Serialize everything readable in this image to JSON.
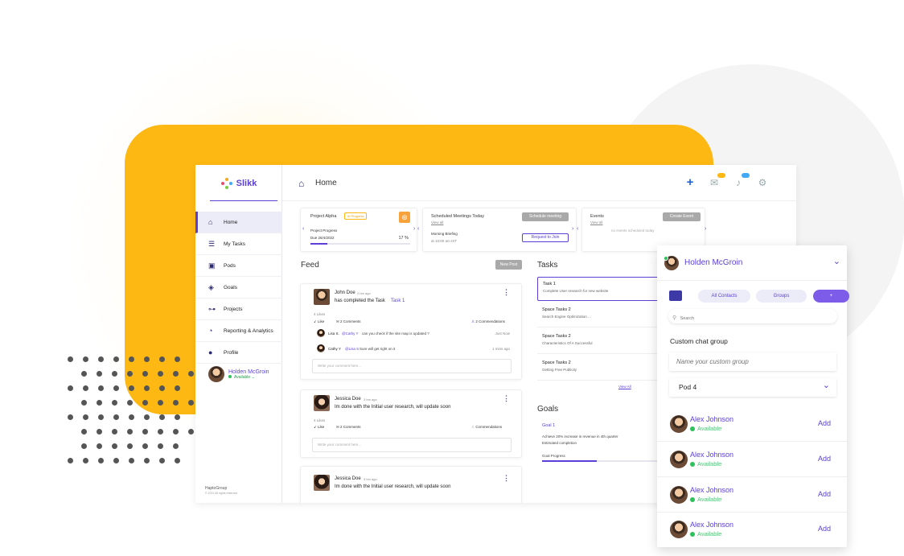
{
  "brand": {
    "name": "Slikk",
    "footer_line1": "HaptoGroup",
    "footer_line2": "© 2021 All rights reserved"
  },
  "colors": {
    "accent": "#5b3fd6",
    "yellow": "#fdb813",
    "available": "#2ec05a"
  },
  "sidebar": {
    "items": [
      {
        "label": "Home",
        "icon": "home-icon"
      },
      {
        "label": "My Tasks",
        "icon": "list-icon"
      },
      {
        "label": "Pods",
        "icon": "pod-icon"
      },
      {
        "label": "Goals",
        "icon": "target-icon"
      },
      {
        "label": "Projects",
        "icon": "projects-icon"
      },
      {
        "label": "Reporting & Analytics",
        "icon": "chart-icon"
      },
      {
        "label": "Profile",
        "icon": "profile-icon"
      }
    ],
    "user": {
      "name": "Holden McGroin",
      "status": "Available ⌄"
    }
  },
  "topbar": {
    "title": "Home"
  },
  "project_card": {
    "name": "Project Alpha",
    "badge": "In Progress",
    "progress_label": "Project Progress",
    "due": "Due 26/4/2022",
    "percent_text": "17 %",
    "percent": 17
  },
  "meetings_card": {
    "title": "Scheduled Meetings Today",
    "link": "View all",
    "button": "Schedule meeting",
    "meeting": "Morning Briefing",
    "time": "at 10:00 am IST",
    "join": "Request to Join"
  },
  "events_card": {
    "title": "Events",
    "link": "View all",
    "button": "Create Event",
    "empty": "no events scheduled today"
  },
  "feed": {
    "title": "Feed",
    "new_post": "New Post",
    "posts": [
      {
        "author": "John Doe",
        "time": "2 hrs ago",
        "text": "has completed the Task",
        "task_link": "Task 1",
        "likes": "4 Likes",
        "like": "Like",
        "comments": "2 Comments",
        "commendations": "2 Commendations",
        "replies": [
          {
            "name": "Lisa S.",
            "mention": "@Cathy Y",
            "text": "can you check if the site map is updated ?",
            "time": "Just Now"
          },
          {
            "name": "Cathy Y",
            "mention": "@Lisa S",
            "text": "Sure will get right on it",
            "time": "1 mins ago"
          }
        ],
        "placeholder": "Write your comment here..."
      },
      {
        "author": "Jessica Doe",
        "time": "3 hrs ago",
        "text": "Im done with the Initial user research, will update soon",
        "likes": "4 Likes",
        "like": "Like",
        "comments": "2 Comments",
        "commendations": "Commendations",
        "placeholder": "Write your comment here..."
      },
      {
        "author": "Jessica Doe",
        "time": "3 hrs ago",
        "text": "Im done with the Initial user research, will update soon"
      }
    ]
  },
  "tasks": {
    "title": "Tasks",
    "items": [
      {
        "name": "Task 1",
        "desc": "Complete User research for new website"
      },
      {
        "name": "Space Tasks 2",
        "desc": "Search Engine Optimization ..."
      },
      {
        "name": "Space Tasks 2",
        "desc": "Characteristics Of A Successful"
      },
      {
        "name": "Space Tasks 2",
        "desc": "Getting Free Publicity"
      }
    ],
    "view_all": "View All"
  },
  "goals": {
    "title": "Goals",
    "name": "Goal 1",
    "desc": "Achieve 20% increase in revenue in 4th quarter",
    "estimated": "Estimated completion",
    "progress_label": "Goal Progress",
    "progress": 0.45
  },
  "chat": {
    "user": "Holden McGroin",
    "tabs": [
      "All Contacts",
      "Groups",
      "+"
    ],
    "search_placeholder": "Search",
    "group_title": "Custom chat group",
    "group_placeholder": "Name your custom group",
    "pod_select": "Pod 4",
    "contacts": [
      {
        "name": "Alex Johnson",
        "status": "Available",
        "action": "Add"
      },
      {
        "name": "Alex Johnson",
        "status": "Available",
        "action": "Add"
      },
      {
        "name": "Alex Johnson",
        "status": "Available",
        "action": "Add"
      },
      {
        "name": "Alex Johnson",
        "status": "Available",
        "action": "Add"
      }
    ]
  }
}
